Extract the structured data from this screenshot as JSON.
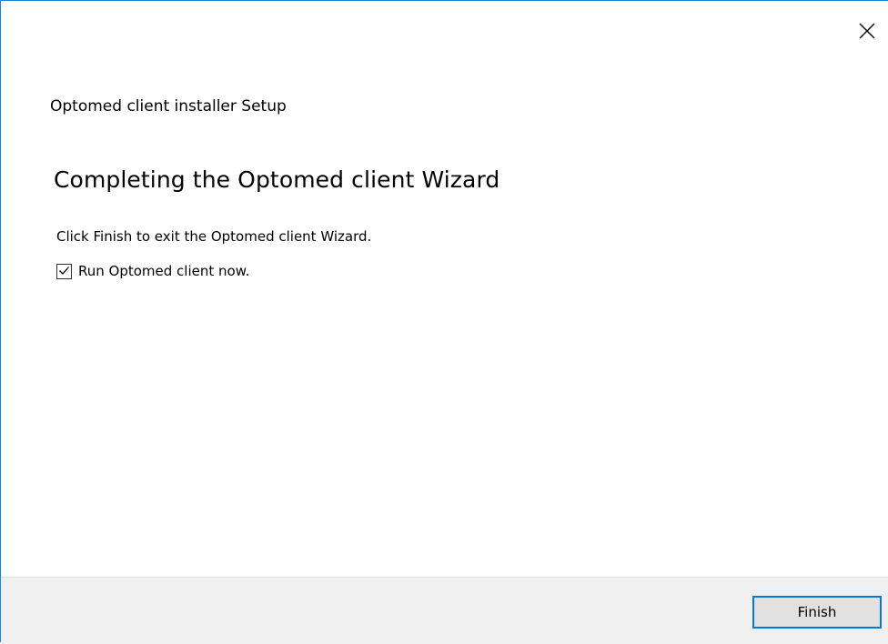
{
  "window": {
    "app_title": "Optomed client installer Setup",
    "close_icon": "close-icon"
  },
  "content": {
    "heading": "Completing the Optomed client Wizard",
    "instructions": "Click Finish to exit the Optomed client Wizard.",
    "run_option": {
      "label": "Run Optomed client now.",
      "checked": true,
      "check_icon": "checkmark-icon"
    }
  },
  "footer": {
    "finish_label": "Finish"
  },
  "colors": {
    "accent": "#0078d7",
    "footer_bg": "#f0f0f0",
    "button_bg": "#e1e1e1"
  }
}
